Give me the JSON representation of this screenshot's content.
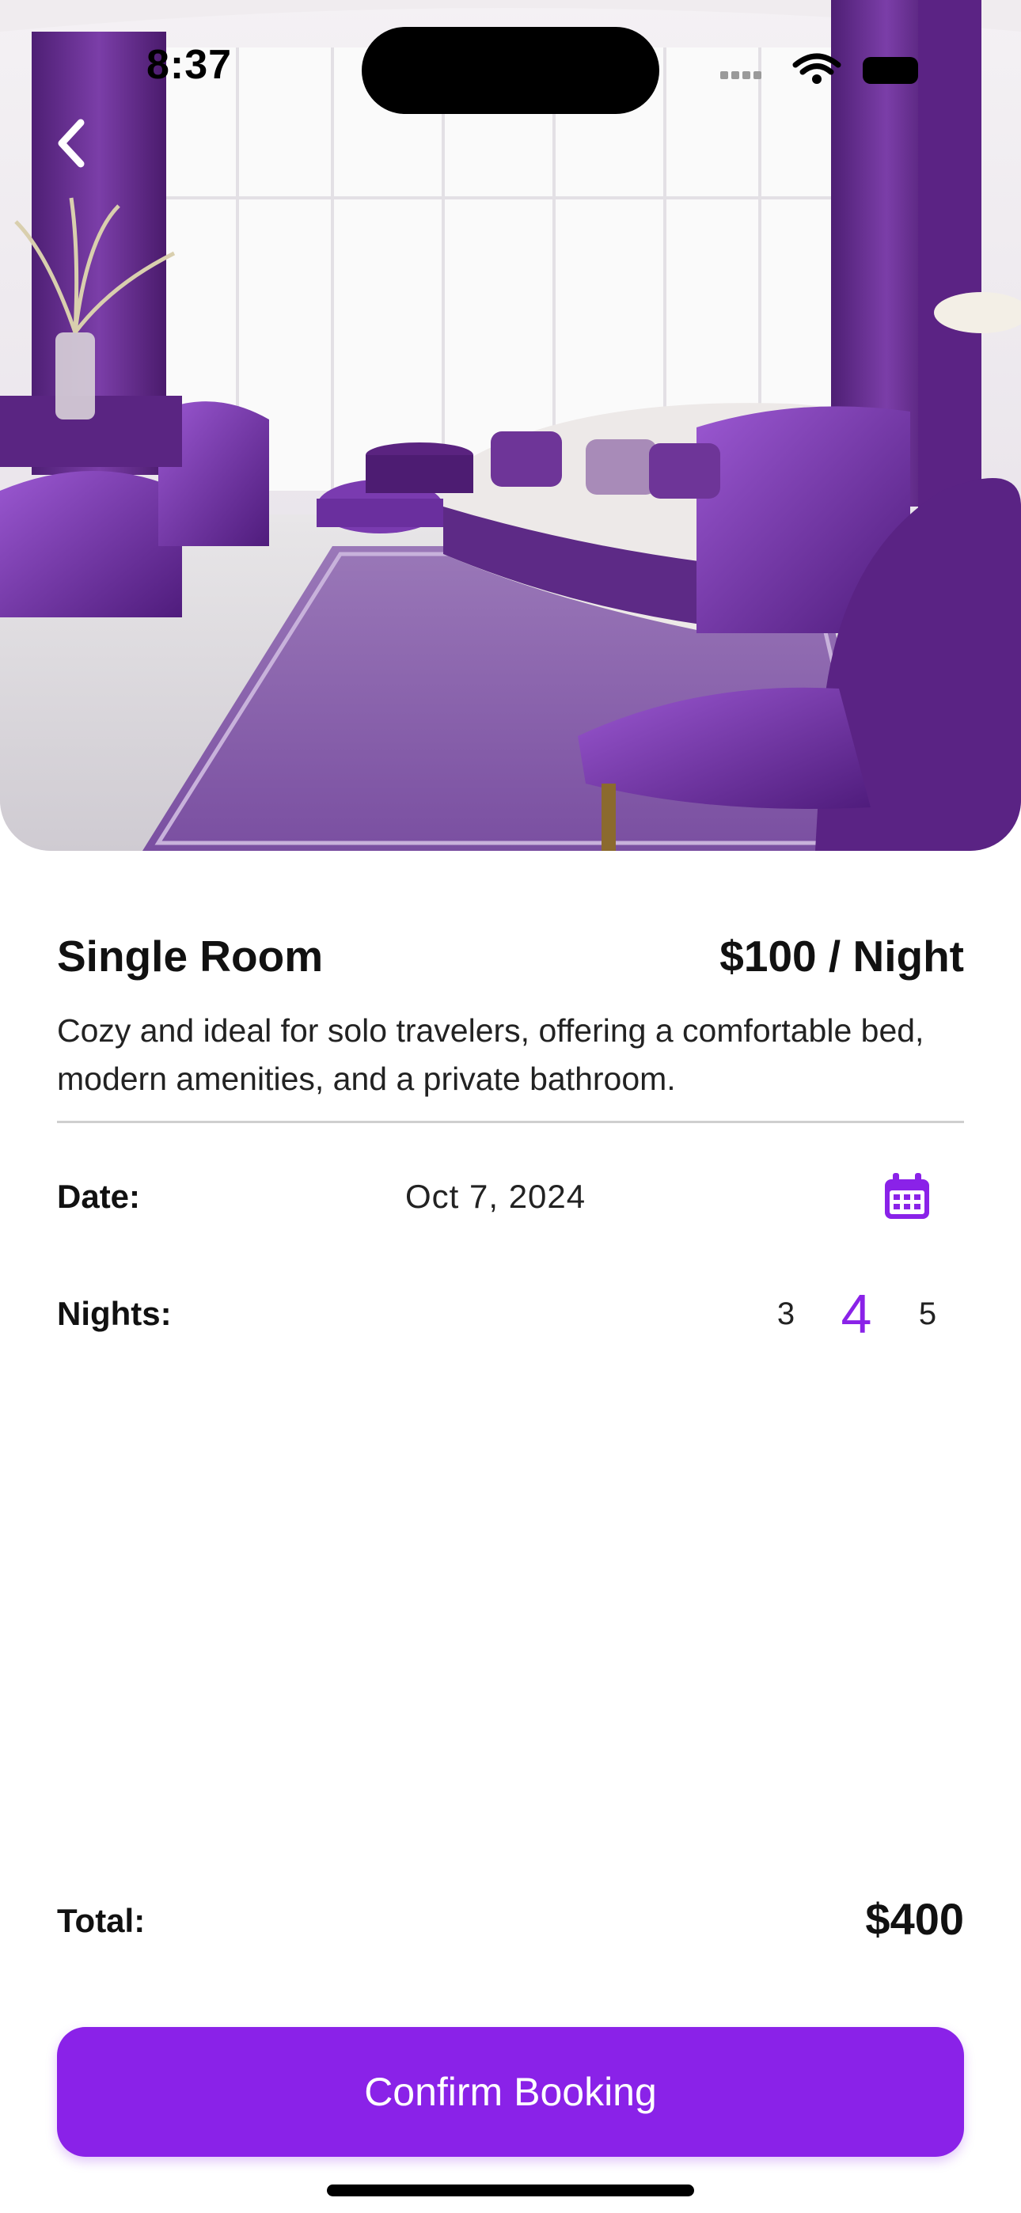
{
  "status_bar": {
    "time": "8:37"
  },
  "room": {
    "name": "Single Room",
    "price": "$100 / Night",
    "description": "Cozy and ideal for solo travelers, offering a comfortable bed, modern amenities, and a private bathroom."
  },
  "booking": {
    "date_label": "Date:",
    "date_value": "Oct 7, 2024",
    "nights_label": "Nights:",
    "nights_options": [
      "3",
      "4",
      "5"
    ],
    "nights_selected": "4",
    "total_label": "Total:",
    "total_value": "$400",
    "confirm_label": "Confirm Booking"
  },
  "icons": {
    "back": "chevron-left-icon",
    "calendar": "calendar-icon",
    "wifi": "wifi-icon",
    "battery": "battery-icon"
  },
  "colors": {
    "accent": "#8a22e8"
  }
}
